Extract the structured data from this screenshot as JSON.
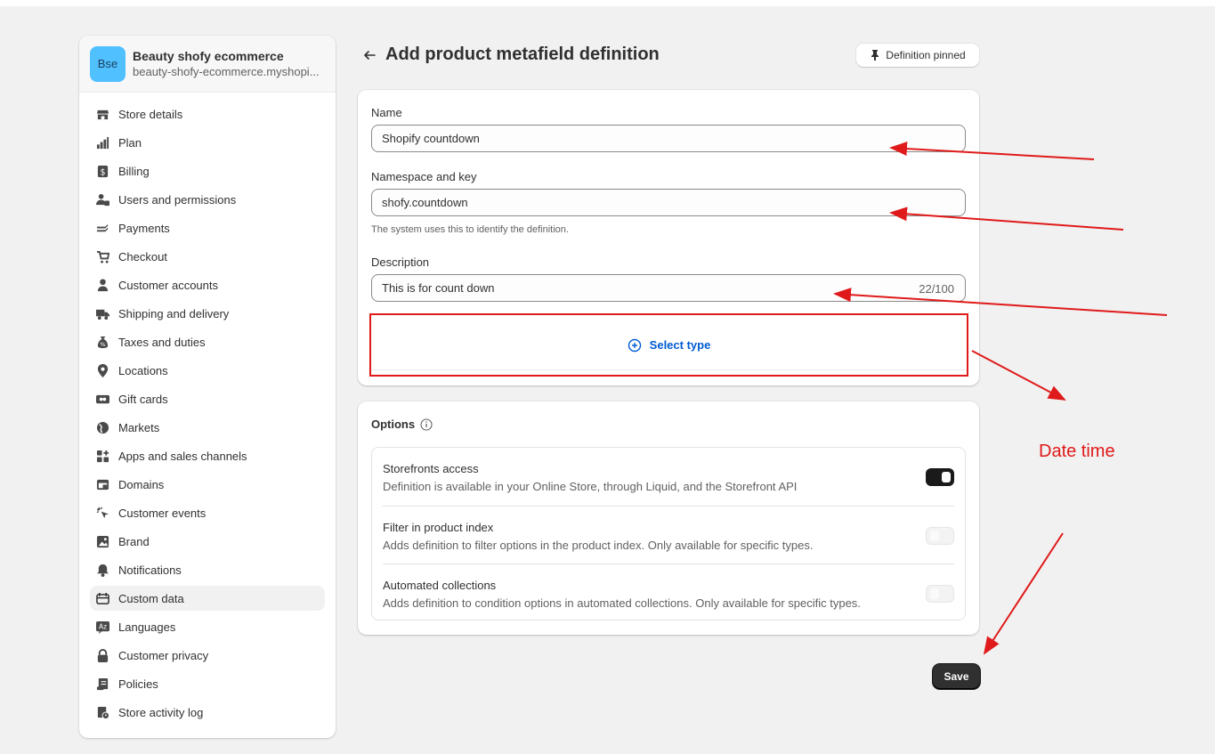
{
  "store": {
    "avatar_initials": "Bse",
    "name": "Beauty shofy ecommerce",
    "domain": "beauty-shofy-ecommerce.myshopi..."
  },
  "sidebar": {
    "items": [
      {
        "label": "Store details",
        "icon": "store-icon"
      },
      {
        "label": "Plan",
        "icon": "plan-icon"
      },
      {
        "label": "Billing",
        "icon": "billing-icon"
      },
      {
        "label": "Users and permissions",
        "icon": "users-icon"
      },
      {
        "label": "Payments",
        "icon": "payments-icon"
      },
      {
        "label": "Checkout",
        "icon": "cart-icon"
      },
      {
        "label": "Customer accounts",
        "icon": "person-icon"
      },
      {
        "label": "Shipping and delivery",
        "icon": "truck-icon"
      },
      {
        "label": "Taxes and duties",
        "icon": "taxes-icon"
      },
      {
        "label": "Locations",
        "icon": "location-icon"
      },
      {
        "label": "Gift cards",
        "icon": "gift-card-icon"
      },
      {
        "label": "Markets",
        "icon": "globe-icon"
      },
      {
        "label": "Apps and sales channels",
        "icon": "apps-icon"
      },
      {
        "label": "Domains",
        "icon": "domains-icon"
      },
      {
        "label": "Customer events",
        "icon": "cursor-click-icon"
      },
      {
        "label": "Brand",
        "icon": "brand-icon"
      },
      {
        "label": "Notifications",
        "icon": "bell-icon"
      },
      {
        "label": "Custom data",
        "icon": "custom-data-icon",
        "active": true
      },
      {
        "label": "Languages",
        "icon": "languages-icon"
      },
      {
        "label": "Customer privacy",
        "icon": "lock-icon"
      },
      {
        "label": "Policies",
        "icon": "policies-icon"
      },
      {
        "label": "Store activity log",
        "icon": "activity-log-icon"
      }
    ]
  },
  "header": {
    "title": "Add product metafield definition",
    "pin_label": "Definition pinned"
  },
  "form": {
    "name_label": "Name",
    "name_value": "Shopify countdown",
    "namespace_label": "Namespace and key",
    "namespace_value": "shofy.countdown",
    "namespace_help": "The system uses this to identify the definition.",
    "description_label": "Description",
    "description_value": "This is for count down",
    "description_counter": "22/100",
    "select_type_label": "Select type"
  },
  "options": {
    "title": "Options",
    "items": [
      {
        "title": "Storefronts access",
        "description": "Definition is available in your Online Store, through Liquid, and the Storefront API",
        "enabled": true
      },
      {
        "title": "Filter in product index",
        "description": "Adds definition to filter options in the product index. Only available for specific types.",
        "enabled": false
      },
      {
        "title": "Automated collections",
        "description": "Adds definition to condition options in automated collections. Only available for specific types.",
        "enabled": false
      }
    ]
  },
  "actions": {
    "save_label": "Save"
  },
  "annotation": {
    "text": "Date time",
    "color": "#e01a1a"
  },
  "colors": {
    "accent": "#005bd3",
    "avatar": "#51c0ff",
    "primary_button": "#303030"
  }
}
